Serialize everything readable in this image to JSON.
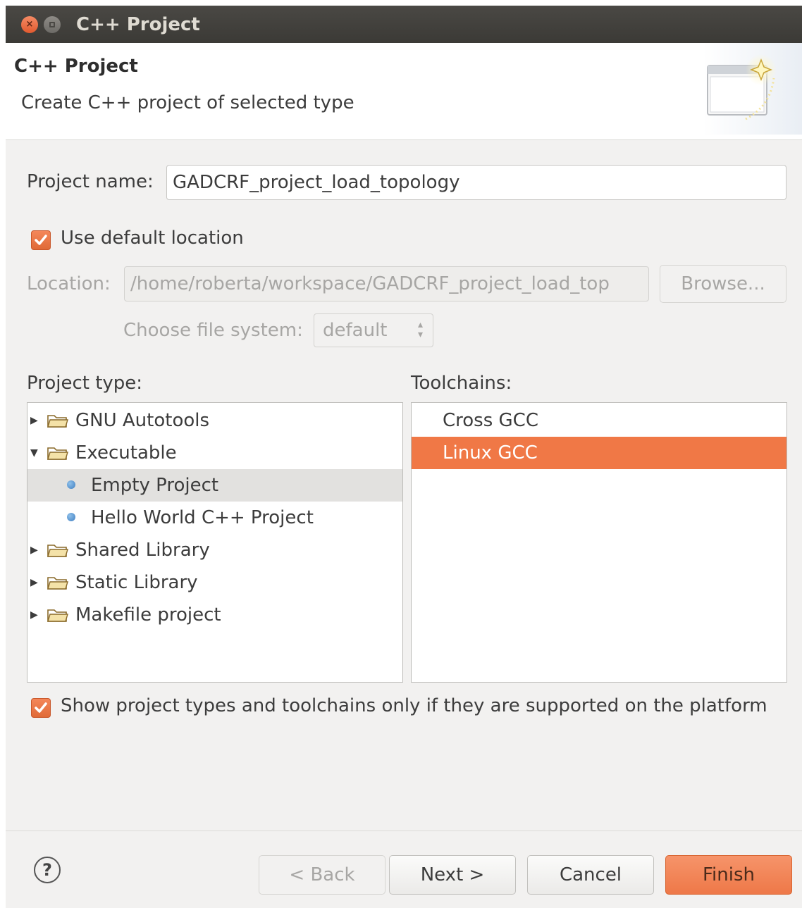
{
  "window": {
    "title": "C++ Project",
    "close_glyph": "×"
  },
  "header": {
    "title": "C++ Project",
    "description": "Create C++ project of selected type"
  },
  "form": {
    "project_name_label": "Project name:",
    "project_name_value": "GADCRF_project_load_topology",
    "use_default_location_label": "Use default location",
    "use_default_location_checked": true,
    "location_label": "Location:",
    "location_value": "/home/roberta/workspace/GADCRF_project_load_top",
    "browse_label": "Browse...",
    "file_system_label": "Choose file system:",
    "file_system_value": "default"
  },
  "project_type": {
    "label": "Project type:",
    "items": [
      {
        "label": "GNU Autotools",
        "kind": "folder",
        "expanded": false
      },
      {
        "label": "Executable",
        "kind": "folder",
        "expanded": true
      },
      {
        "label": "Empty Project",
        "kind": "leaf",
        "selected": true
      },
      {
        "label": "Hello World C++ Project",
        "kind": "leaf"
      },
      {
        "label": "Shared Library",
        "kind": "folder",
        "expanded": false
      },
      {
        "label": "Static Library",
        "kind": "folder",
        "expanded": false
      },
      {
        "label": "Makefile project",
        "kind": "folder",
        "expanded": false
      }
    ]
  },
  "toolchains": {
    "label": "Toolchains:",
    "items": [
      {
        "label": "Cross GCC"
      },
      {
        "label": "Linux GCC",
        "selected": true
      }
    ]
  },
  "show_supported": {
    "label": "Show project types and toolchains only if they are supported on the platform",
    "checked": true
  },
  "footer": {
    "help_glyph": "?",
    "back_label": "< Back",
    "next_label": "Next >",
    "cancel_label": "Cancel",
    "finish_label": "Finish"
  },
  "colors": {
    "accent": "#f07846",
    "titlebar": "#3b3a36"
  }
}
